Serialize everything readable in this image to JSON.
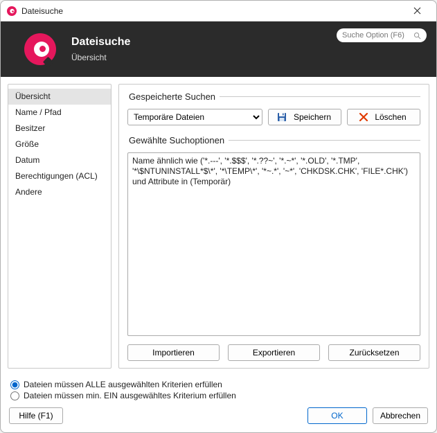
{
  "window": {
    "title": "Dateisuche"
  },
  "header": {
    "title": "Dateisuche",
    "subtitle": "Übersicht",
    "search_placeholder": "Suche Option (F6)"
  },
  "sidebar": {
    "items": [
      {
        "label": "Übersicht",
        "selected": true
      },
      {
        "label": "Name / Pfad",
        "selected": false
      },
      {
        "label": "Besitzer",
        "selected": false
      },
      {
        "label": "Größe",
        "selected": false
      },
      {
        "label": "Datum",
        "selected": false
      },
      {
        "label": "Berechtigungen (ACL)",
        "selected": false
      },
      {
        "label": "Andere",
        "selected": false
      }
    ]
  },
  "saved_searches": {
    "legend": "Gespeicherte Suchen",
    "selected": "Temporäre Dateien",
    "options": [
      "Temporäre Dateien"
    ],
    "save_label": "Speichern",
    "delete_label": "Löschen"
  },
  "selected_options": {
    "legend": "Gewählte Suchoptionen",
    "criteria_text": "Name ähnlich wie ('*.---', '*.$$$', '*.??~', '*.~*', '*.OLD', '*.TMP', '*\\$NTUNINSTALL*$\\*', '*\\TEMP\\*', '*~.*', '~*', 'CHKDSK.CHK', 'FILE*.CHK') und Attribute in (Temporär)"
  },
  "action_buttons": {
    "import": "Importieren",
    "export": "Exportieren",
    "reset": "Zurücksetzen"
  },
  "radios": {
    "all_label": "Dateien müssen ALLE ausgewählten Kriterien erfüllen",
    "one_label": "Dateien müssen min. EIN ausgewähltes Kriterium erfüllen",
    "selected": "all"
  },
  "footer": {
    "help": "Hilfe (F1)",
    "ok": "OK",
    "cancel": "Abbrechen"
  },
  "icons": {
    "save": "save-icon",
    "delete": "delete-icon",
    "close": "close-icon",
    "search": "search-icon",
    "app": "app-logo-icon"
  }
}
